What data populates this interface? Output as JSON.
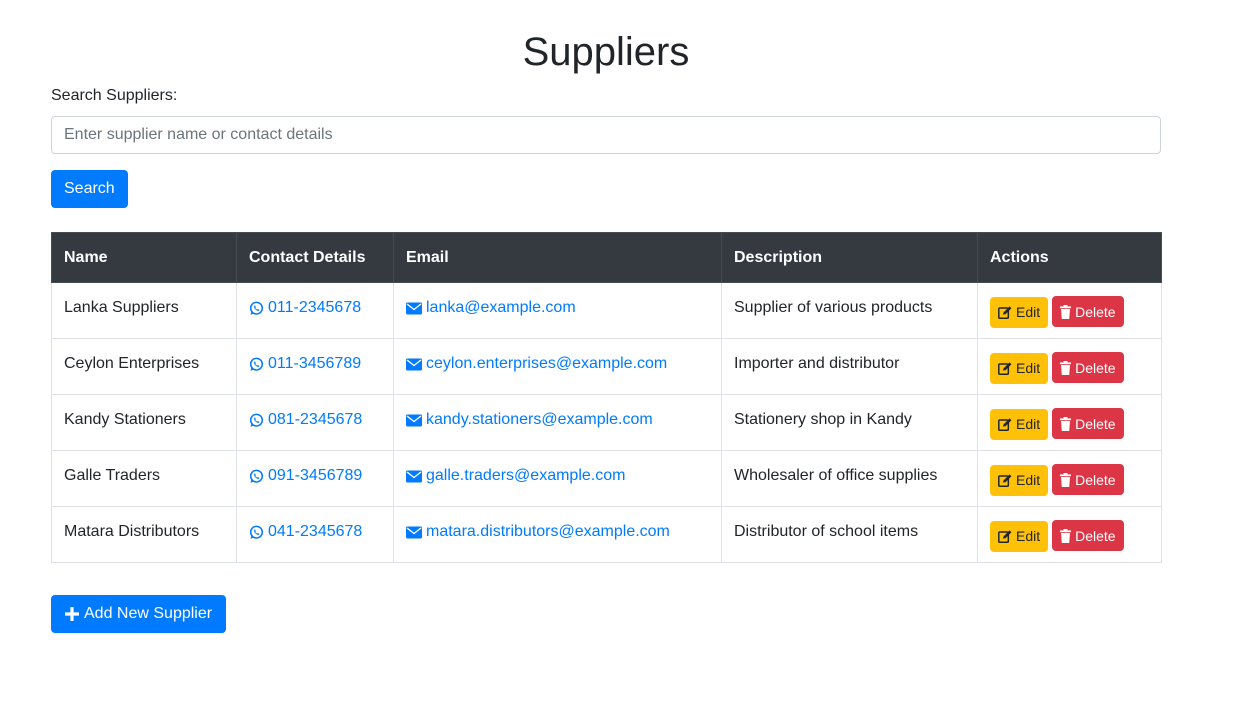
{
  "page": {
    "title": "Suppliers"
  },
  "search": {
    "label": "Search Suppliers:",
    "placeholder": "Enter supplier name or contact details",
    "button_label": "Search"
  },
  "table": {
    "headers": [
      "Name",
      "Contact Details",
      "Email",
      "Description",
      "Actions"
    ],
    "rows": [
      {
        "name": "Lanka Suppliers",
        "contact": "011-2345678",
        "email": "lanka@example.com",
        "description": "Supplier of various products",
        "edit_label": "Edit",
        "delete_label": "Delete"
      },
      {
        "name": "Ceylon Enterprises",
        "contact": "011-3456789",
        "email": "ceylon.enterprises@example.com",
        "description": "Importer and distributor",
        "edit_label": "Edit",
        "delete_label": "Delete"
      },
      {
        "name": "Kandy Stationers",
        "contact": "081-2345678",
        "email": "kandy.stationers@example.com",
        "description": "Stationery shop in Kandy",
        "edit_label": "Edit",
        "delete_label": "Delete"
      },
      {
        "name": "Galle Traders",
        "contact": "091-3456789",
        "email": "galle.traders@example.com",
        "description": "Wholesaler of office supplies",
        "edit_label": "Edit",
        "delete_label": "Delete"
      },
      {
        "name": "Matara Distributors",
        "contact": "041-2345678",
        "email": "matara.distributors@example.com",
        "description": "Distributor of school items",
        "edit_label": "Edit",
        "delete_label": "Delete"
      }
    ]
  },
  "add_button": {
    "label": "Add New Supplier"
  },
  "icons": {
    "contact": "whatsapp-icon",
    "email": "envelope-icon",
    "edit": "edit-icon",
    "delete": "trash-icon",
    "add": "plus-icon"
  },
  "colors": {
    "primary": "#007bff",
    "warning": "#ffc107",
    "danger": "#dc3545",
    "table_header": "#343a40"
  }
}
